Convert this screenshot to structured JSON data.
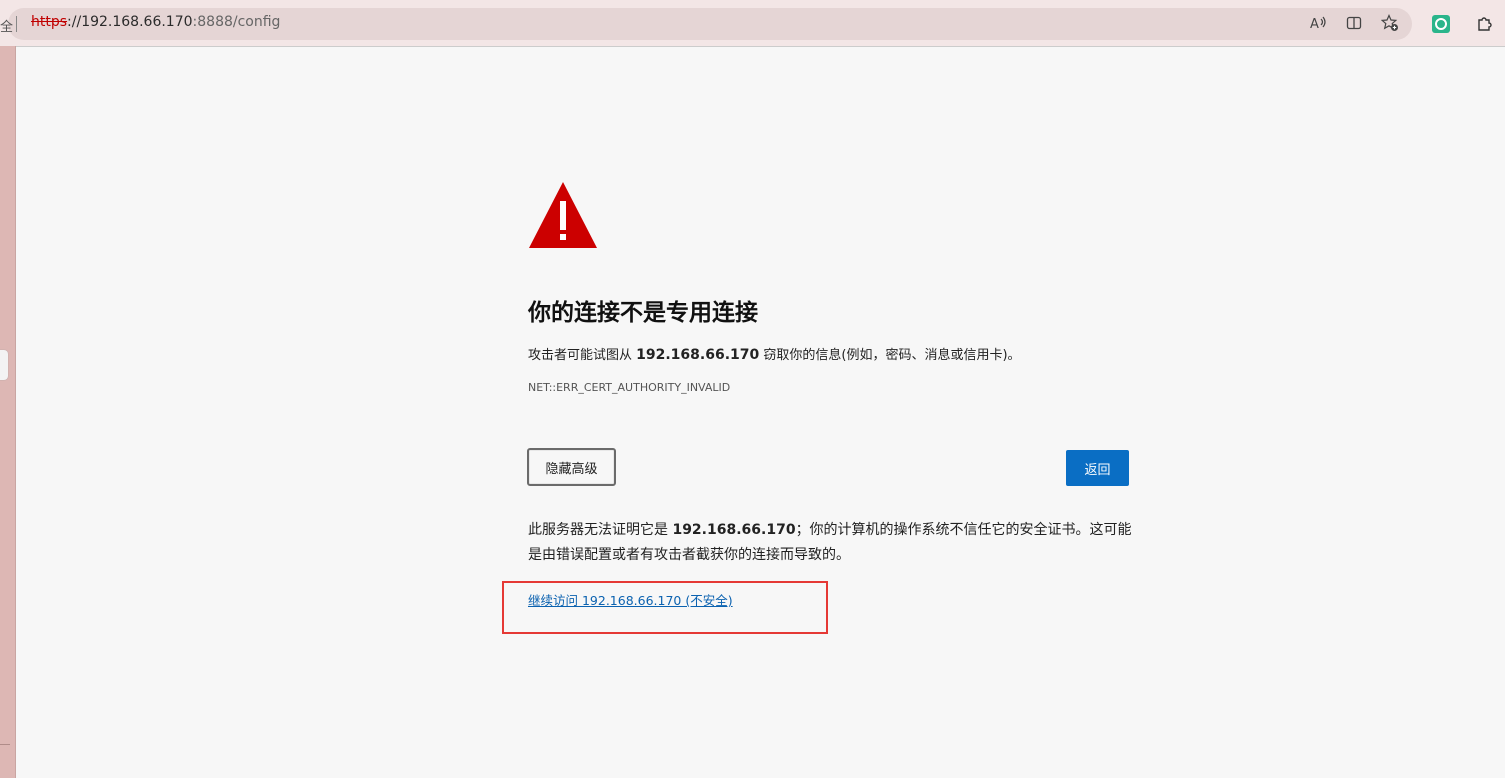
{
  "browser": {
    "left_fragment": "全",
    "url_scheme": "https",
    "url_host": "://192.168.66.170",
    "url_rest": ":8888/config",
    "icons": [
      "read-aloud-icon",
      "split-screen-icon",
      "favorites-icon",
      "extension-icon",
      "extensions-puzzle-icon"
    ]
  },
  "page": {
    "title": "你的连接不是专用连接",
    "desc_prefix": "攻击者可能试图从 ",
    "desc_host": "192.168.66.170",
    "desc_suffix": " 窃取你的信息(例如，密码、消息或信用卡)。",
    "error_code": "NET::ERR_CERT_AUTHORITY_INVALID",
    "hide_advanced_label": "隐藏高级",
    "back_label": "返回",
    "detail_prefix": "此服务器无法证明它是 ",
    "detail_host": "192.168.66.170",
    "detail_suffix": "；你的计算机的操作系统不信任它的安全证书。这可能是由错误配置或者有攻击者截获你的连接而导致的。",
    "proceed_link": "继续访问 192.168.66.170 (不安全)"
  },
  "colors": {
    "warning_red": "#cc0000",
    "button_blue": "#0a6ec4",
    "highlight_red": "#e53935",
    "link_blue": "#0b62b0"
  }
}
